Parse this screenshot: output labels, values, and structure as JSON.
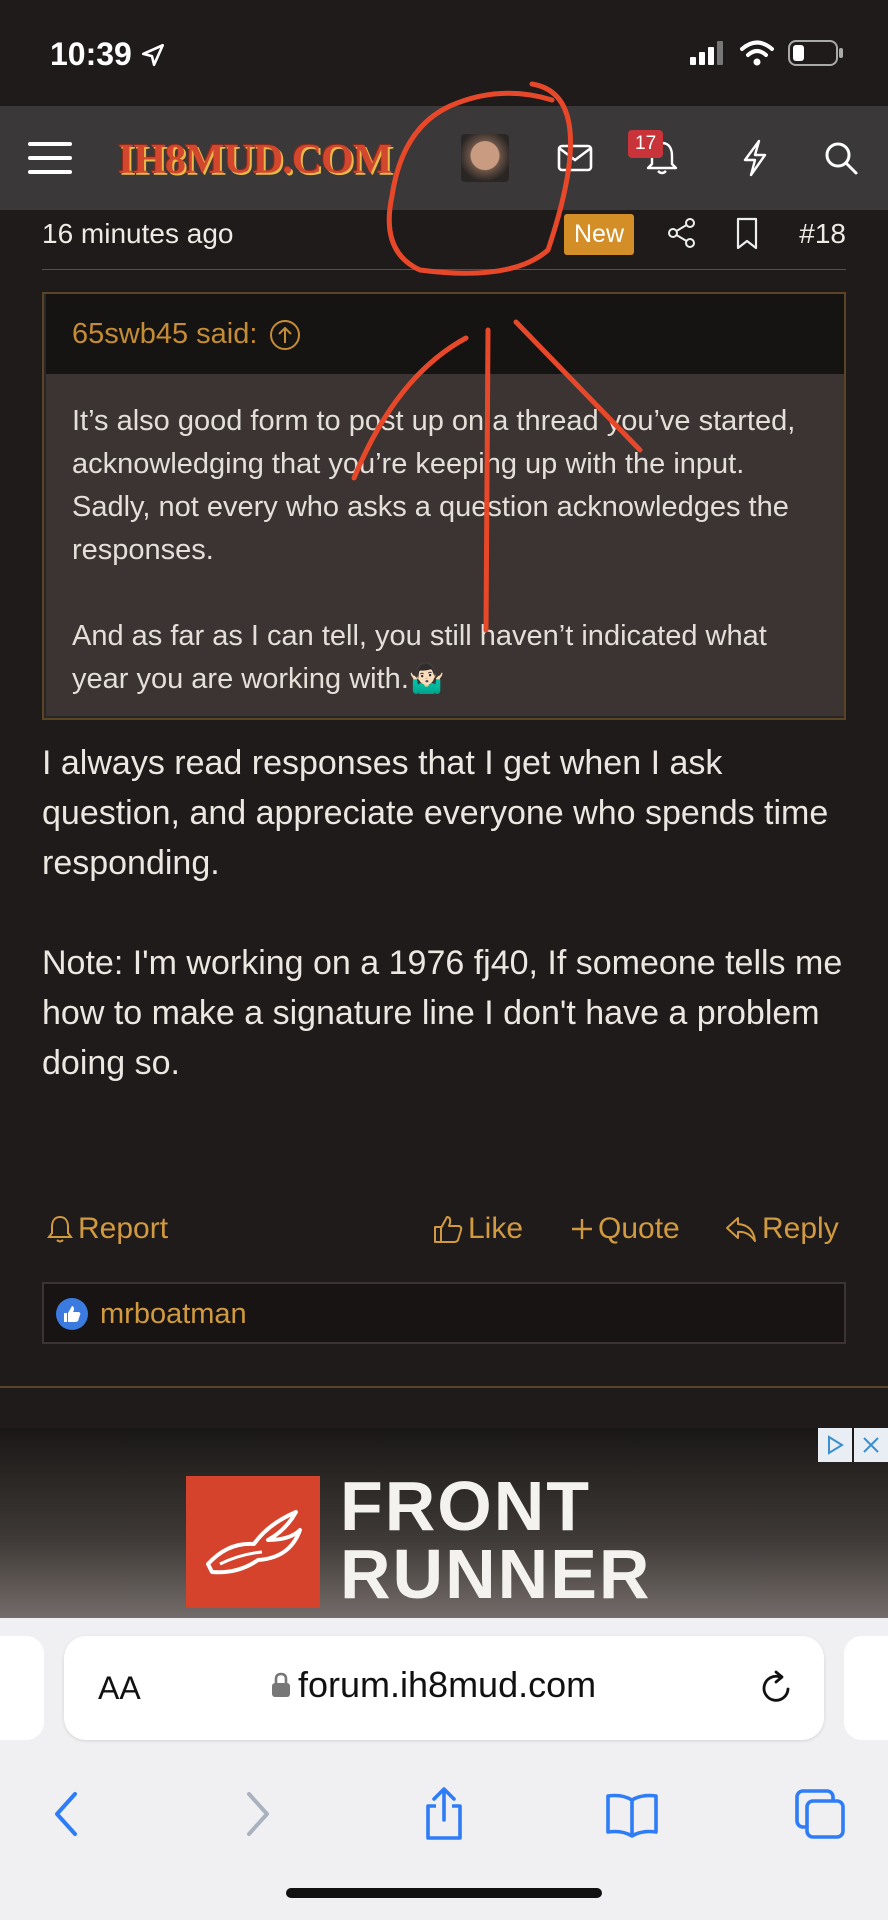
{
  "status_bar": {
    "time": "10:39"
  },
  "nav": {
    "logo": "IH8MUD.COM",
    "notification_count": "17",
    "icons": [
      "menu-icon",
      "avatar",
      "mail-icon",
      "bell-icon",
      "lightning-icon",
      "search-icon"
    ]
  },
  "post": {
    "time_ago": "16 minutes ago",
    "new_badge": "New",
    "post_number": "#18",
    "quote": {
      "author_line": "65swb45 said:",
      "paragraphs": [
        "It’s also good form to post up on a thread you’ve started, acknowledging that you’re keeping up with the input. Sadly, not every who asks a question acknowledges the responses.",
        "And as far as I can tell, you still haven’t indicated what year you are working with.🤷🏻‍♂️"
      ]
    },
    "message": [
      "I always read responses that I get when I ask question, and appreciate everyone who spends time responding.",
      "Note: I'm working on a 1976 fj40, If someone tells me how to make a signature line I don't have a problem doing so."
    ],
    "actions": {
      "report": "Report",
      "like": "Like",
      "quote": "Quote",
      "reply": "Reply"
    },
    "liked_by": "mrboatman"
  },
  "ad": {
    "line1": "FRONT",
    "line2": "RUNNER"
  },
  "safari": {
    "aa_label": "AA",
    "url": "forum.ih8mud.com"
  },
  "colors": {
    "accent": "#d19a40",
    "new_badge": "#d48e28",
    "annotation": "#e8482a",
    "background": "#1f1b1b"
  }
}
